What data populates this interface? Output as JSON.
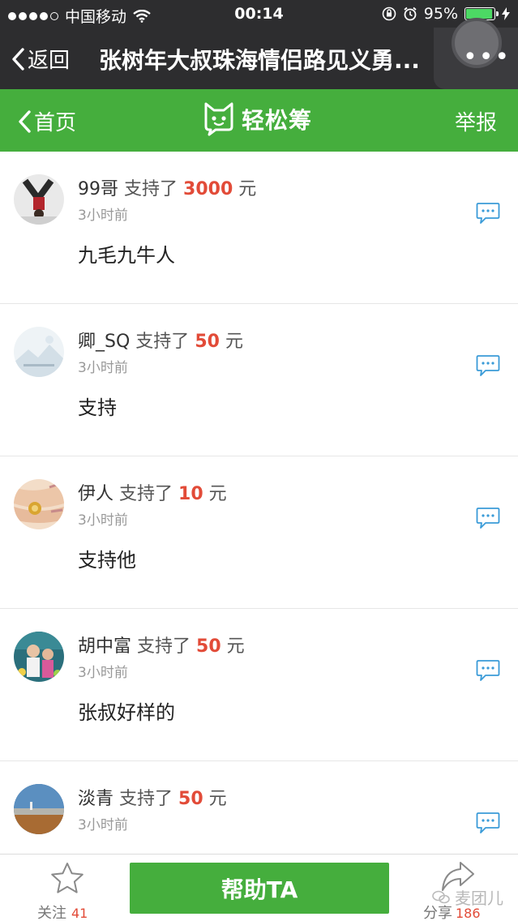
{
  "status_bar": {
    "carrier": "中国移动",
    "time": "00:14",
    "battery": "95%",
    "battery_level": 0.95
  },
  "wx_nav": {
    "back_label": "返回",
    "title": "张树年大叔珠海情侣路见义勇..."
  },
  "header": {
    "home_label": "首页",
    "brand_name": "轻松筹",
    "report_label": "举报"
  },
  "feed": [
    {
      "name": "99哥",
      "support_text": "支持了",
      "amount": "3000",
      "unit": "元",
      "time": "3小时前",
      "message": "九毛九牛人"
    },
    {
      "name": "卿_SQ",
      "support_text": "支持了",
      "amount": "50",
      "unit": "元",
      "time": "3小时前",
      "message": "支持"
    },
    {
      "name": "伊人",
      "support_text": "支持了",
      "amount": "10",
      "unit": "元",
      "time": "3小时前",
      "message": "支持他"
    },
    {
      "name": "胡中富",
      "support_text": "支持了",
      "amount": "50",
      "unit": "元",
      "time": "3小时前",
      "message": "张叔好样的"
    },
    {
      "name": "淡青",
      "support_text": "支持了",
      "amount": "50",
      "unit": "元",
      "time": "3小时前",
      "message": ""
    }
  ],
  "bottom_bar": {
    "follow_label": "关注",
    "follow_count": "41",
    "help_button": "帮助TA",
    "share_label": "分享",
    "share_count": "186",
    "watermark": "麦团儿"
  }
}
